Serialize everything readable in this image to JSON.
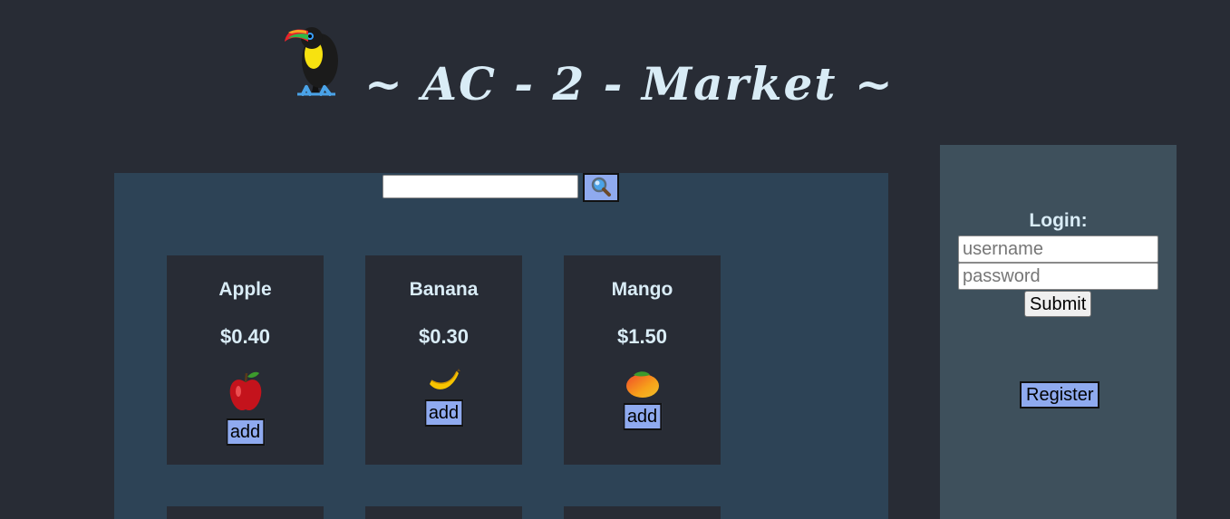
{
  "header": {
    "title": "~ AC - 2 - Market ~",
    "logo_icon": "toucan-icon"
  },
  "search": {
    "value": "",
    "placeholder": "",
    "button_icon": "magnifier-icon"
  },
  "products": [
    {
      "name": "Apple",
      "price": "$0.40",
      "icon": "apple-icon",
      "add_label": "add"
    },
    {
      "name": "Banana",
      "price": "$0.30",
      "icon": "banana-icon",
      "add_label": "add"
    },
    {
      "name": "Mango",
      "price": "$1.50",
      "icon": "mango-icon",
      "add_label": "add"
    }
  ],
  "login": {
    "title": "Login:",
    "username_placeholder": "username",
    "password_placeholder": "password",
    "submit_label": "Submit",
    "register_label": "Register"
  },
  "colors": {
    "page_bg": "#282c35",
    "main_panel_bg": "#2d4356",
    "login_panel_bg": "#3e505c",
    "accent_button": "#8faaef",
    "title_text": "#d9ecf6"
  }
}
